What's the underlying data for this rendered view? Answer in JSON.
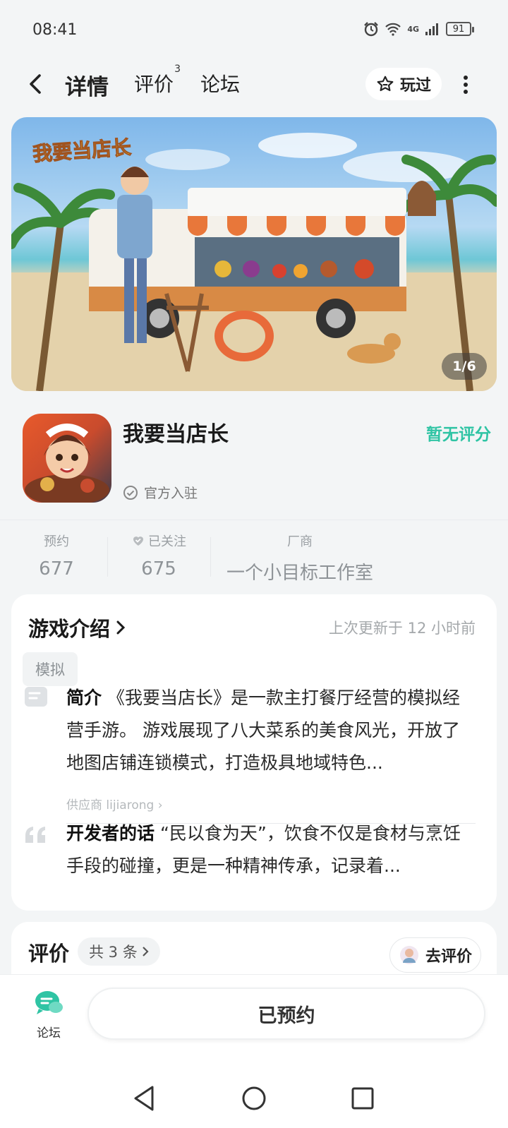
{
  "status": {
    "time": "08:41",
    "battery": "91",
    "net": "4G"
  },
  "nav": {
    "tabs": [
      {
        "label": "详情"
      },
      {
        "label": "评价",
        "badge": "3"
      },
      {
        "label": "论坛"
      }
    ],
    "played_label": "玩过"
  },
  "banner": {
    "counter": "1/6",
    "logo_text": "我要当店长"
  },
  "game": {
    "name": "我要当店长",
    "score": "暂无评分",
    "official": "官方入驻"
  },
  "stats": [
    {
      "label": "预约",
      "value": "677"
    },
    {
      "label": "已关注",
      "value": "675"
    },
    {
      "label": "厂商",
      "value": "一个小目标工作室"
    }
  ],
  "intro": {
    "title": "游戏介绍",
    "updated": "上次更新于 12 小时前",
    "tag": "模拟",
    "summary_label": "简介",
    "summary_text": "《我要当店长》是一款主打餐厅经营的模拟经营手游。 游戏展现了八大菜系的美食风光，开放了地图店铺连锁模式，打造极具地域特色...",
    "supplier": "供应商 lijiarong",
    "dev_label": "开发者的话",
    "dev_text": "“民以食为天”，饮食不仅是食材与烹饪手段的碰撞，更是一种精神传承，记录着..."
  },
  "rating": {
    "title": "评价",
    "count": "共 3 条",
    "go_label": "去评价"
  },
  "bottom": {
    "forum_label": "论坛",
    "reserved_label": "已预约"
  },
  "colors": {
    "accent": "#2fc4a4",
    "highlight": "#29d3b0"
  }
}
